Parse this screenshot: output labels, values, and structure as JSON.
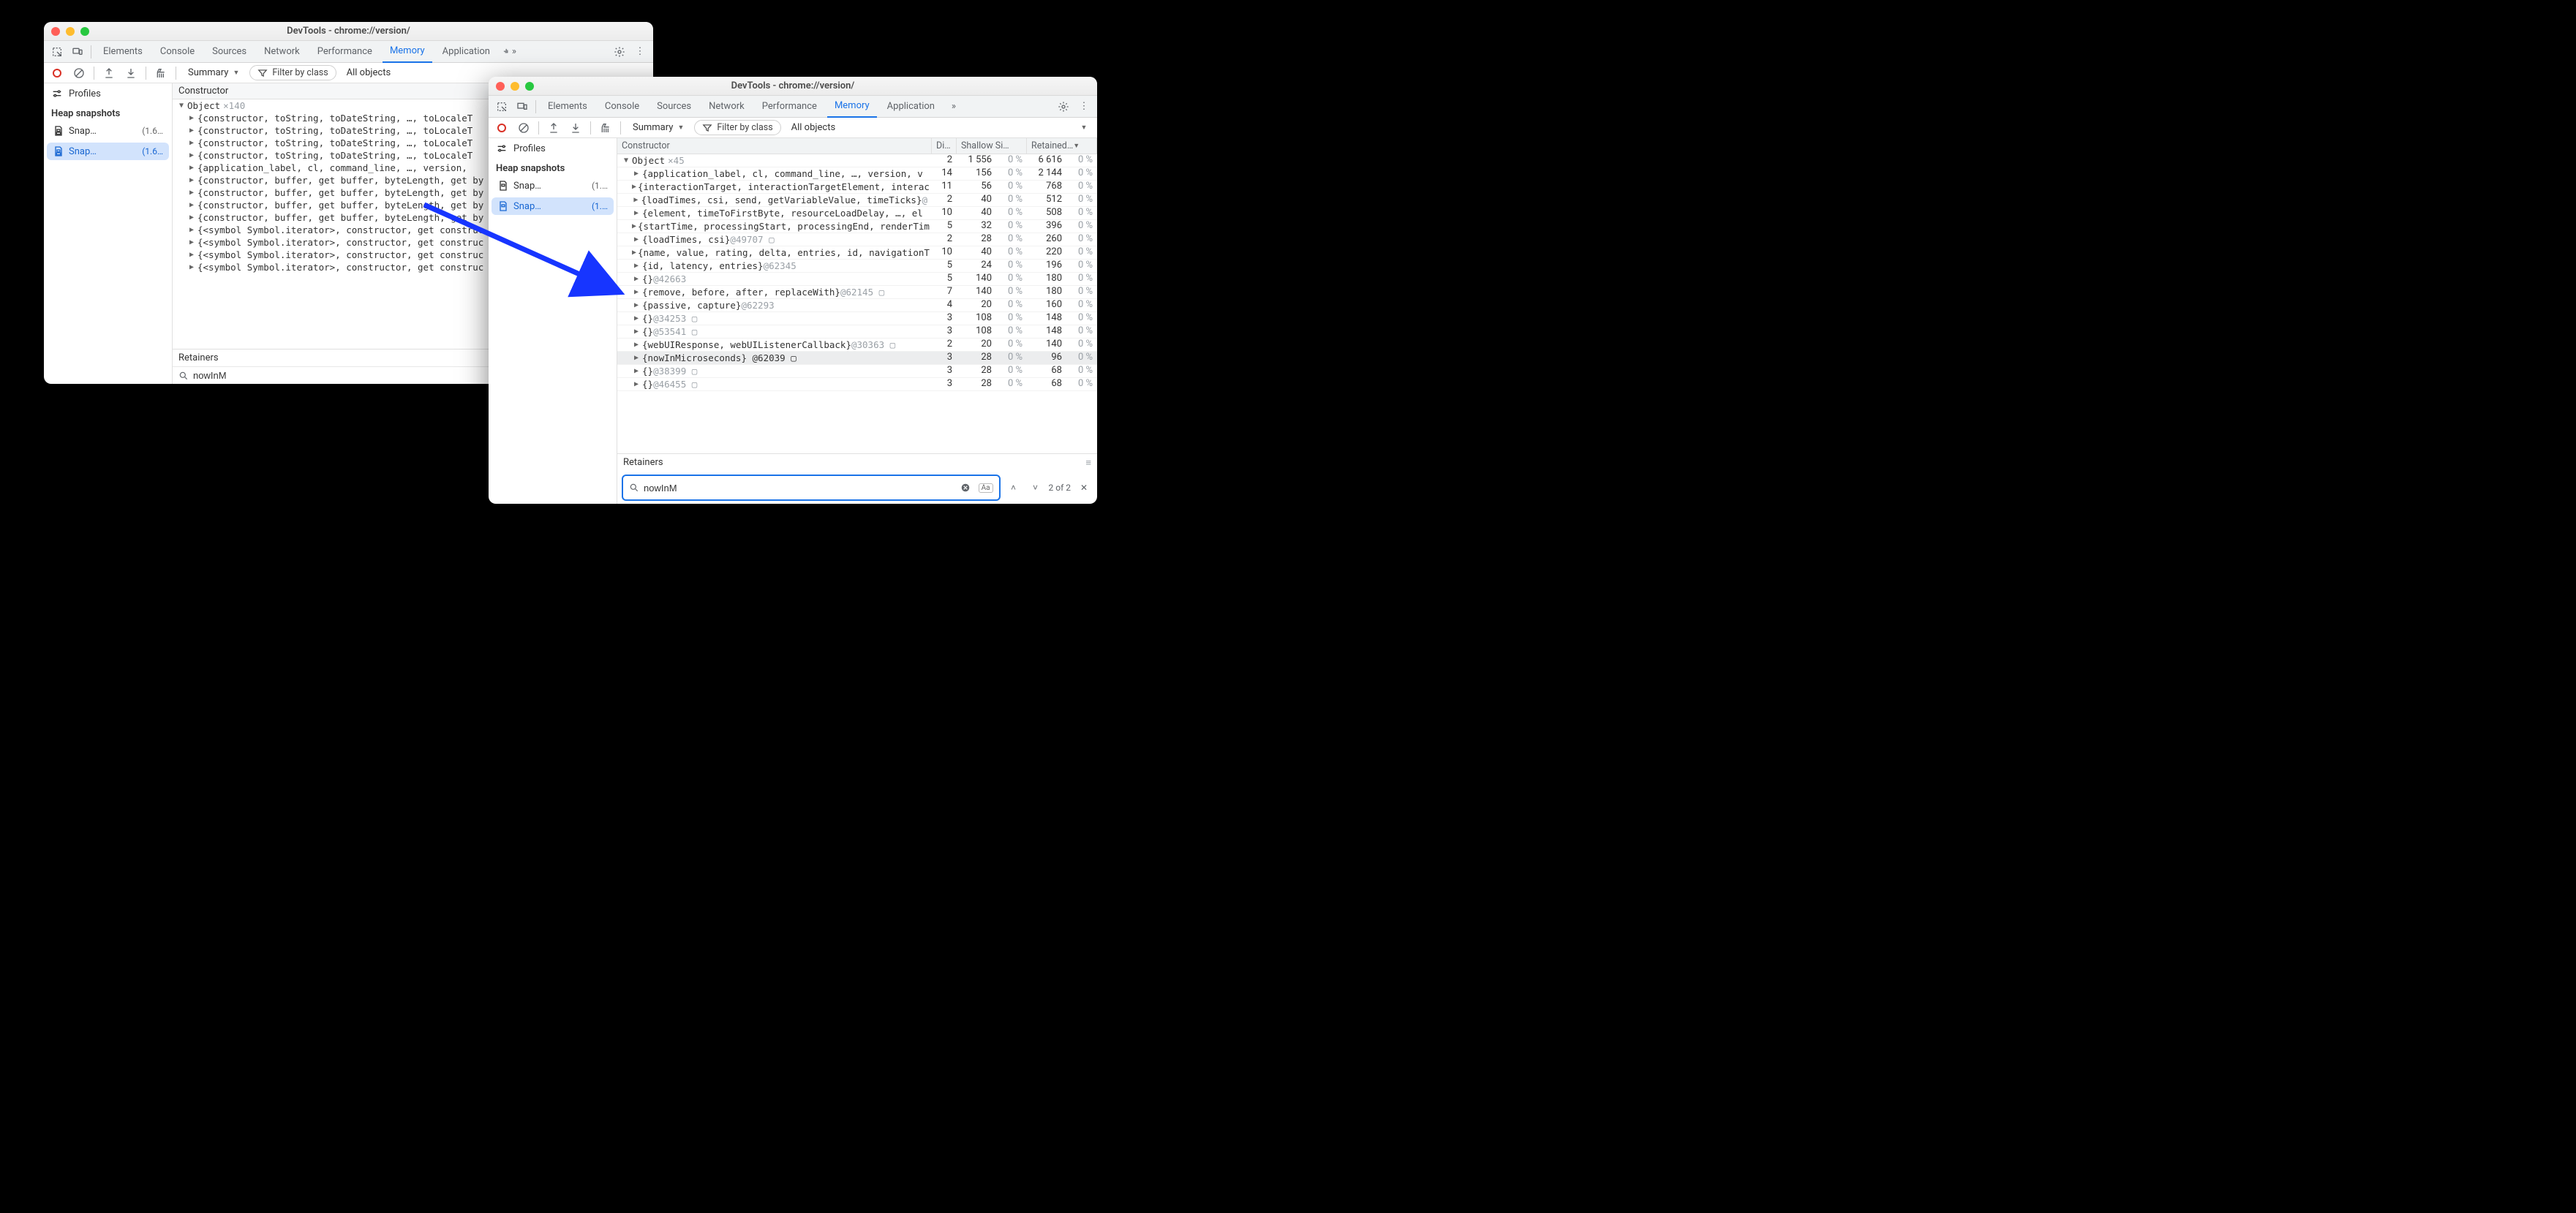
{
  "window1": {
    "title": "DevTools - chrome://version/",
    "tabs": [
      "Elements",
      "Console",
      "Sources",
      "Network",
      "Performance",
      "Memory",
      "Application"
    ],
    "active_tab": "Memory",
    "toolbar": {
      "view": "Summary",
      "filter_label": "Filter by class",
      "objects": "All objects"
    },
    "sidebar": {
      "profiles_label": "Profiles",
      "group": "Heap snapshots",
      "items": [
        {
          "label": "Snap…",
          "size": "(1.6…"
        },
        {
          "label": "Snap…",
          "size": "(1.6…"
        }
      ]
    },
    "constructor_header": "Constructor",
    "object_root": {
      "label": "Object",
      "count": "×140"
    },
    "rows": [
      "{constructor, toString, toDateString, …, toLocaleT",
      "{constructor, toString, toDateString, …, toLocaleT",
      "{constructor, toString, toDateString, …, toLocaleT",
      "{constructor, toString, toDateString, …, toLocaleT",
      "{application_label, cl, command_line, …, version, ",
      "{constructor, buffer, get buffer, byteLength, get by",
      "{constructor, buffer, get buffer, byteLength, get by",
      "{constructor, buffer, get buffer, byteLength, get by",
      "{constructor, buffer, get buffer, byteLength, get by",
      "{<symbol Symbol.iterator>, constructor, get construc",
      "{<symbol Symbol.iterator>, constructor, get construc",
      "{<symbol Symbol.iterator>, constructor, get construc",
      "{<symbol Symbol.iterator>, constructor, get construc"
    ],
    "retainers_label": "Retainers",
    "search_value": "nowInM"
  },
  "window2": {
    "title": "DevTools - chrome://version/",
    "tabs": [
      "Elements",
      "Console",
      "Sources",
      "Network",
      "Performance",
      "Memory",
      "Application"
    ],
    "active_tab": "Memory",
    "toolbar": {
      "view": "Summary",
      "filter_label": "Filter by class",
      "objects": "All objects"
    },
    "sidebar": {
      "profiles_label": "Profiles",
      "group": "Heap snapshots",
      "items": [
        {
          "label": "Snap…",
          "size": "(1.…"
        },
        {
          "label": "Snap…",
          "size": "(1.…"
        }
      ]
    },
    "headers": {
      "constructor": "Constructor",
      "dist": "Di…",
      "shallow": "Shallow Si…",
      "retained": "Retained…"
    },
    "object_root": {
      "label": "Object",
      "count": "×45",
      "dist": "2",
      "shallow": "1 556",
      "shallow_pct": "0 %",
      "retained": "6 616",
      "retained_pct": "0 %"
    },
    "rows": [
      {
        "label": "{application_label, cl, command_line, …, version, v",
        "dist": "14",
        "shallow": "156",
        "sp": "0 %",
        "retained": "2 144",
        "rp": "0 %"
      },
      {
        "label": "{interactionTarget, interactionTargetElement, interac",
        "dist": "11",
        "shallow": "56",
        "sp": "0 %",
        "retained": "768",
        "rp": "0 %"
      },
      {
        "label": "{loadTimes, csi, send, getVariableValue, timeTicks}",
        "tail": "@",
        "dist": "2",
        "shallow": "40",
        "sp": "0 %",
        "retained": "512",
        "rp": "0 %"
      },
      {
        "label": "{element, timeToFirstByte, resourceLoadDelay, …, el",
        "dist": "10",
        "shallow": "40",
        "sp": "0 %",
        "retained": "508",
        "rp": "0 %"
      },
      {
        "label": "{startTime, processingStart, processingEnd, renderTim",
        "dist": "5",
        "shallow": "32",
        "sp": "0 %",
        "retained": "396",
        "rp": "0 %"
      },
      {
        "label": "{loadTimes, csi}",
        "tail": "@49707 ▢",
        "dist": "2",
        "shallow": "28",
        "sp": "0 %",
        "retained": "260",
        "rp": "0 %"
      },
      {
        "label": "{name, value, rating, delta, entries, id, navigationT",
        "dist": "10",
        "shallow": "40",
        "sp": "0 %",
        "retained": "220",
        "rp": "0 %"
      },
      {
        "label": "{id, latency, entries}",
        "tail": "@62345",
        "dist": "5",
        "shallow": "24",
        "sp": "0 %",
        "retained": "196",
        "rp": "0 %"
      },
      {
        "label": "{}",
        "tail": "@42663",
        "dist": "5",
        "shallow": "140",
        "sp": "0 %",
        "retained": "180",
        "rp": "0 %"
      },
      {
        "label": "{remove, before, after, replaceWith}",
        "tail": "@62145 ▢",
        "dist": "7",
        "shallow": "140",
        "sp": "0 %",
        "retained": "180",
        "rp": "0 %"
      },
      {
        "label": "{passive, capture}",
        "tail": "@62293",
        "dist": "4",
        "shallow": "20",
        "sp": "0 %",
        "retained": "160",
        "rp": "0 %"
      },
      {
        "label": "{}",
        "tail": "@34253 ▢",
        "dist": "3",
        "shallow": "108",
        "sp": "0 %",
        "retained": "148",
        "rp": "0 %"
      },
      {
        "label": "{}",
        "tail": "@53541 ▢",
        "dist": "3",
        "shallow": "108",
        "sp": "0 %",
        "retained": "148",
        "rp": "0 %"
      },
      {
        "label": "{webUIResponse, webUIListenerCallback}",
        "tail": "@30363 ▢",
        "dist": "2",
        "shallow": "20",
        "sp": "0 %",
        "retained": "140",
        "rp": "0 %"
      },
      {
        "label": "{nowInMicroseconds} @62039 ▢",
        "selected": true,
        "dist": "3",
        "shallow": "28",
        "sp": "0 %",
        "retained": "96",
        "rp": "0 %"
      },
      {
        "label": "{}",
        "tail": "@38399 ▢",
        "dist": "3",
        "shallow": "28",
        "sp": "0 %",
        "retained": "68",
        "rp": "0 %"
      },
      {
        "label": "{}",
        "tail": "@46455 ▢",
        "dist": "3",
        "shallow": "28",
        "sp": "0 %",
        "retained": "68",
        "rp": "0 %"
      }
    ],
    "retainers_label": "Retainers",
    "search_value": "nowInM",
    "search_counter": "2 of 2",
    "match_case": "Aa"
  }
}
